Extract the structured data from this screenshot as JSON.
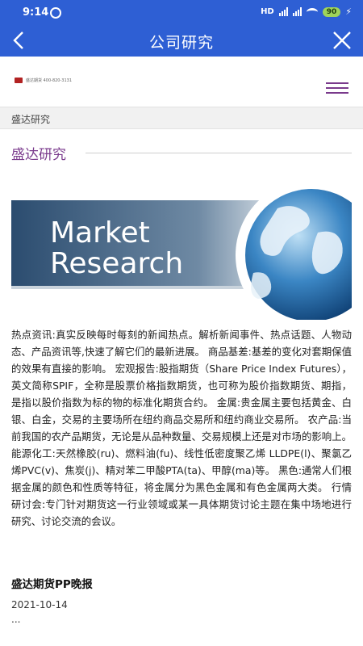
{
  "status_bar": {
    "time": "9:14",
    "network": "HD",
    "battery": "90"
  },
  "nav_bar": {
    "title": "公司研究"
  },
  "header": {
    "logo_text": "盛达期货 400-820-3131"
  },
  "breadcrumb": {
    "label": "盛达研究"
  },
  "section": {
    "title": "盛达研究"
  },
  "banner": {
    "line1": "Market",
    "line2": "Research"
  },
  "article": {
    "body": "热点资讯:真实反映每时每刻的新闻热点。解析新闻事件、热点话题、人物动态、产品资讯等,快速了解它们的最新进展。 商品基差:基差的变化对套期保值的效果有直接的影响。 宏观报告:股指期货（Share Price Index Futures），英文简称SPIF，全称是股票价格指数期货，也可称为股价指数期货、期指，是指以股价指数为标的物的标准化期货合约。 金属:贵金属主要包括黄金、白银、白金，交易的主要场所在纽约商品交易所和纽约商业交易所。 农产品:当前我国的农产品期货，无论是从品种数量、交易规模上还是对市场的影响上。 能源化工:天然橡胶(ru)、燃料油(fu)、线性低密度聚乙烯 LLDPE(l)、聚氯乙烯PVC(v)、焦炭(j)、精对苯二甲酸PTA(ta)、甲醇(ma)等。 黑色:通常人们根据金属的颜色和性质等特征，将金属分为黑色金属和有色金属两大类。 行情研讨会:专门针对期货这一行业领域或某一具体期货讨论主题在集中场地进行研究、讨论交流的会议。"
  },
  "news": {
    "title": "盛达期货PP晚报",
    "date": "2021-10-14",
    "excerpt": "..."
  },
  "colors": {
    "bar_blue": "#2e5fd4",
    "accent_purple": "#7a3a8c"
  }
}
